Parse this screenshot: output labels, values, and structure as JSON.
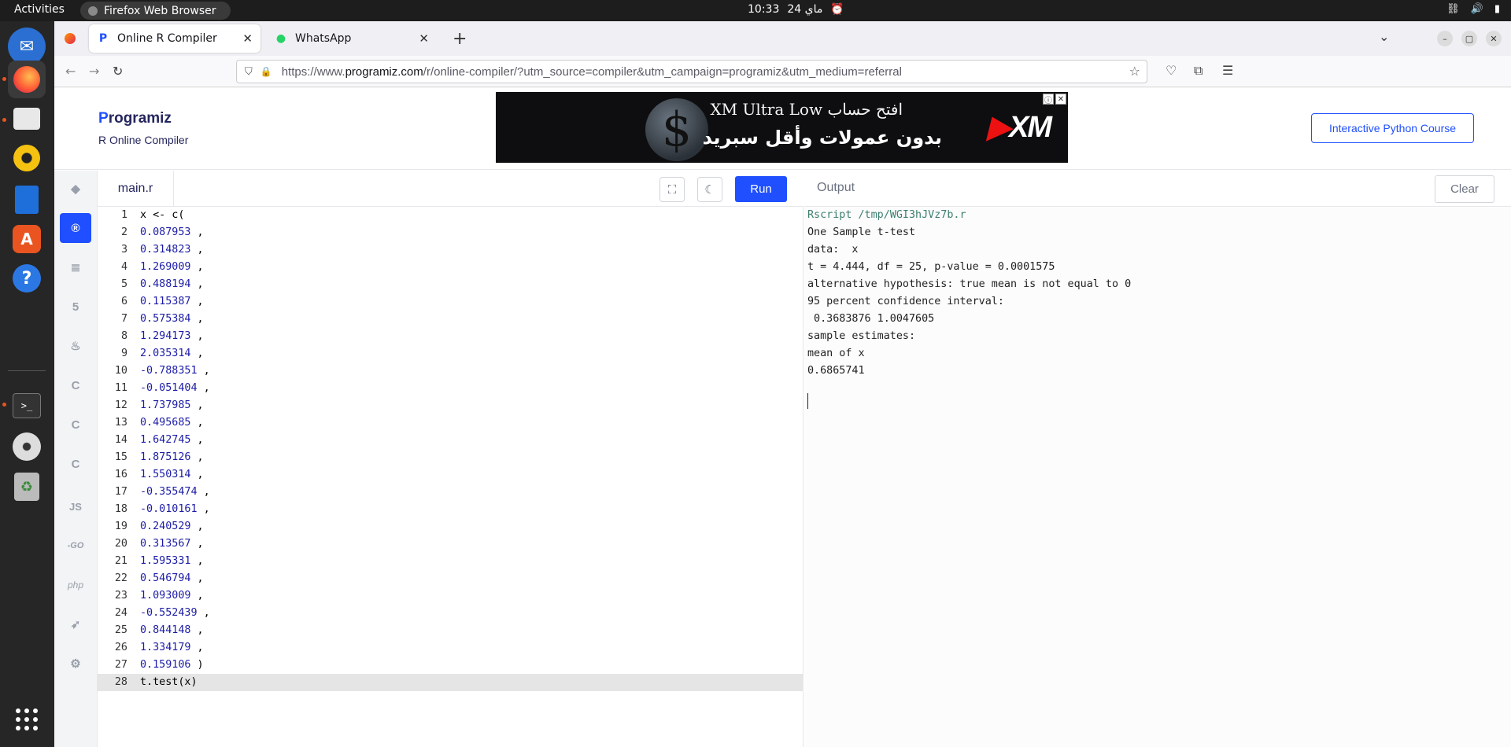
{
  "topbar": {
    "activities": "Activities",
    "app_name": "Firefox Web Browser",
    "date": "ماي 24",
    "time": "10:33"
  },
  "dock": {
    "items": [
      "thunderbird-icon",
      "firefox-icon",
      "files-icon",
      "rhythmbox-icon",
      "writer-icon",
      "app-center-icon",
      "help-icon",
      "terminal-icon",
      "disc-icon",
      "trash-icon",
      "app-grid-icon"
    ]
  },
  "browser": {
    "tabs": [
      {
        "title": "Online R Compiler",
        "active": true
      },
      {
        "title": "WhatsApp",
        "active": false
      }
    ],
    "url_prefix": "https://www.",
    "url_domain": "programiz.com",
    "url_path": "/r/online-compiler/?utm_source=compiler&utm_campaign=programiz&utm_medium=referral"
  },
  "site": {
    "logo_text": "rogramiz",
    "logo_initial": "P",
    "subtitle": "R Online Compiler",
    "course_button": "Interactive Python Course",
    "ad": {
      "line1": "XM Ultra Low افتح حساب",
      "line2": "بدون عمولات وأقل سبريد",
      "brand": "XM"
    }
  },
  "languages": [
    "python",
    "r",
    "sql",
    "html",
    "java",
    "c",
    "cpp",
    "csharp",
    "js",
    "go",
    "php",
    "swift",
    "rust"
  ],
  "languages_text": {
    "js": "JS",
    "go": "-GO",
    "php": "php"
  },
  "editor": {
    "filename": "main.r",
    "run_label": "Run",
    "lines": [
      {
        "n": "1",
        "code": "x <- c("
      },
      {
        "n": "2",
        "code": "0.087953 ,"
      },
      {
        "n": "3",
        "code": "0.314823 ,"
      },
      {
        "n": "4",
        "code": "1.269009 ,"
      },
      {
        "n": "5",
        "code": "0.488194 ,"
      },
      {
        "n": "6",
        "code": "0.115387 ,"
      },
      {
        "n": "7",
        "code": "0.575384 ,"
      },
      {
        "n": "8",
        "code": "1.294173 ,"
      },
      {
        "n": "9",
        "code": "2.035314 ,"
      },
      {
        "n": "10",
        "code": "-0.788351 ,"
      },
      {
        "n": "11",
        "code": "-0.051404 ,"
      },
      {
        "n": "12",
        "code": "1.737985 ,"
      },
      {
        "n": "13",
        "code": "0.495685 ,"
      },
      {
        "n": "14",
        "code": "1.642745 ,"
      },
      {
        "n": "15",
        "code": "1.875126 ,"
      },
      {
        "n": "16",
        "code": "1.550314 ,"
      },
      {
        "n": "17",
        "code": "-0.355474 ,"
      },
      {
        "n": "18",
        "code": "-0.010161 ,"
      },
      {
        "n": "19",
        "code": "0.240529 ,"
      },
      {
        "n": "20",
        "code": "0.313567 ,"
      },
      {
        "n": "21",
        "code": "1.595331 ,"
      },
      {
        "n": "22",
        "code": "0.546794 ,"
      },
      {
        "n": "23",
        "code": "1.093009 ,"
      },
      {
        "n": "24",
        "code": "-0.552439 ,"
      },
      {
        "n": "25",
        "code": "0.844148 ,"
      },
      {
        "n": "26",
        "code": "1.334179 ,"
      },
      {
        "n": "27",
        "code": "0.159106 )"
      },
      {
        "n": "28",
        "code": "t.test(x)"
      }
    ]
  },
  "output": {
    "title": "Output",
    "clear_label": "Clear",
    "lines": [
      "Rscript /tmp/WGI3hJVz7b.r",
      "One Sample t-test",
      "data:  x",
      "t = 4.444, df = 25, p-value = 0.0001575",
      "alternative hypothesis: true mean is not equal to 0",
      "95 percent confidence interval:",
      " 0.3683876 1.0047605",
      "sample estimates:",
      "mean of x",
      "0.6865741"
    ]
  }
}
